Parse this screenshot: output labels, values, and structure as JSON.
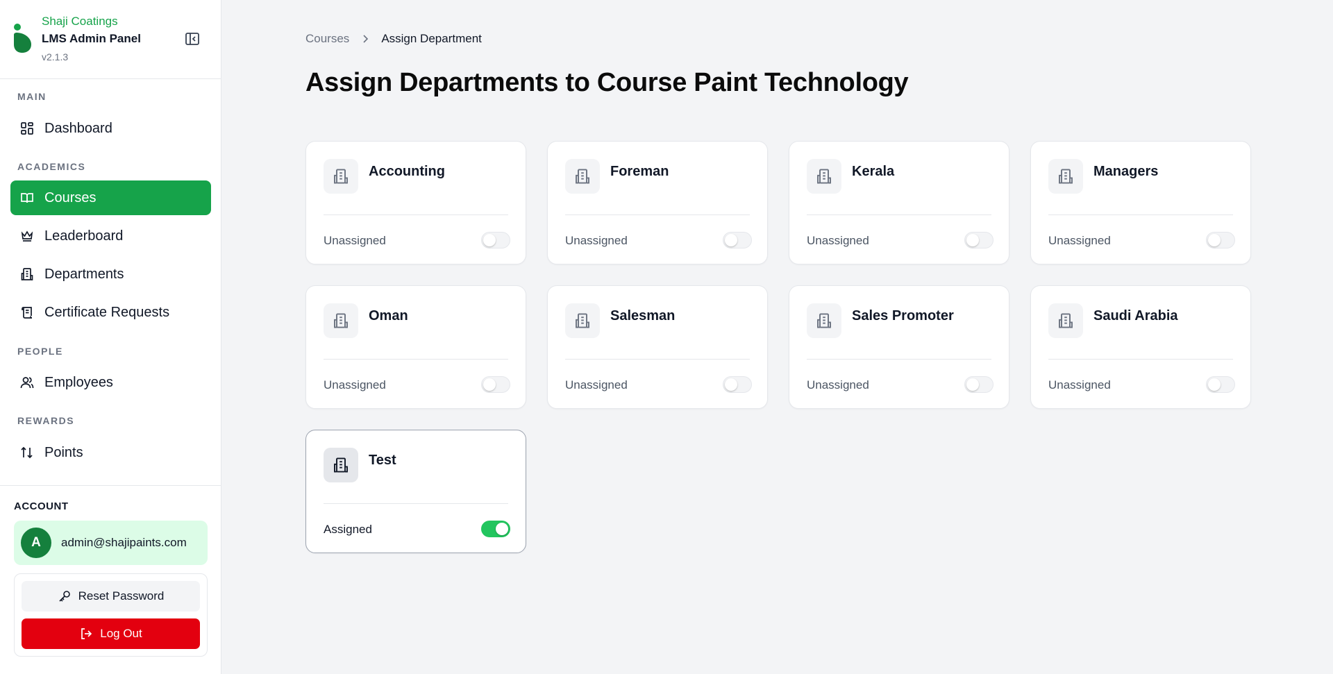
{
  "app": {
    "company": "Shaji Coatings",
    "title": "LMS Admin Panel",
    "version": "v2.1.3"
  },
  "sidebar": {
    "sections": {
      "main": "MAIN",
      "academics": "ACADEMICS",
      "people": "PEOPLE",
      "rewards": "REWARDS"
    },
    "items": {
      "dashboard": "Dashboard",
      "courses": "Courses",
      "leaderboard": "Leaderboard",
      "departments": "Departments",
      "certificates": "Certificate Requests",
      "employees": "Employees",
      "points": "Points"
    },
    "active_item": "courses"
  },
  "account": {
    "label": "ACCOUNT",
    "avatar_initial": "A",
    "email": "admin@shajipaints.com",
    "reset_password_label": "Reset Password",
    "logout_label": "Log Out"
  },
  "breadcrumb": {
    "parent": "Courses",
    "current": "Assign Department"
  },
  "page_title": "Assign Departments to Course Paint Technology",
  "departments": [
    {
      "name": "Accounting",
      "status": "Unassigned",
      "assigned": false
    },
    {
      "name": "Foreman",
      "status": "Unassigned",
      "assigned": false
    },
    {
      "name": "Kerala",
      "status": "Unassigned",
      "assigned": false
    },
    {
      "name": "Managers",
      "status": "Unassigned",
      "assigned": false
    },
    {
      "name": "Oman",
      "status": "Unassigned",
      "assigned": false
    },
    {
      "name": "Salesman",
      "status": "Unassigned",
      "assigned": false
    },
    {
      "name": "Sales Promoter",
      "status": "Unassigned",
      "assigned": false
    },
    {
      "name": "Saudi Arabia",
      "status": "Unassigned",
      "assigned": false
    },
    {
      "name": "Test",
      "status": "Assigned",
      "assigned": true
    }
  ],
  "colors": {
    "brand": "#16a34a",
    "toggle_on": "#22c55e",
    "logout": "#e3000f",
    "account_card": "#dcfce7"
  },
  "icons": {
    "department": "building-icon",
    "breadcrumb_separator": "chevron-right-icon"
  }
}
